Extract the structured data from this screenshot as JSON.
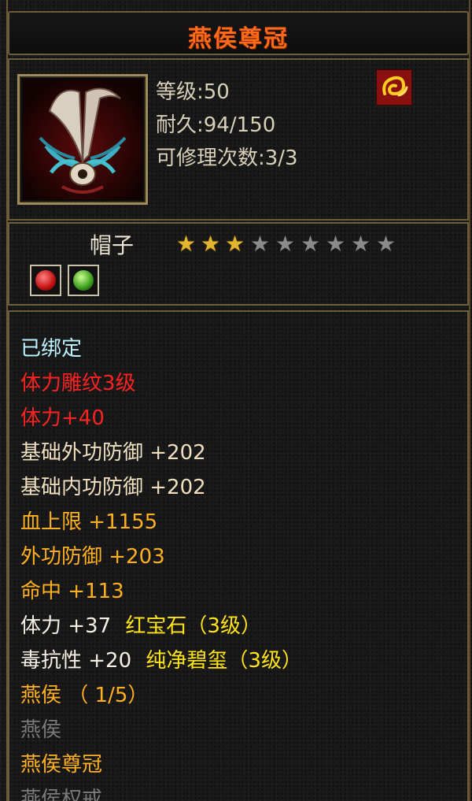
{
  "title": "燕侯尊冠",
  "info": {
    "level": "等级:50",
    "durability": "耐久:94/150",
    "repairs": "可修理次数:3/3"
  },
  "item_type": "帽子",
  "stars": {
    "filled": 3,
    "total": 9
  },
  "attributes": [
    {
      "text": "已绑定",
      "color": "cyan"
    },
    {
      "text": "体力雕纹3级",
      "color": "red"
    },
    {
      "text": "体力+40",
      "color": "red"
    },
    {
      "text": "基础外功防御 +202",
      "color": "beige"
    },
    {
      "text": "基础内功防御 +202",
      "color": "beige"
    },
    {
      "text": "血上限 +1155",
      "color": "orange"
    },
    {
      "text": "外功防御 +203",
      "color": "orange"
    },
    {
      "text": "命中 +113",
      "color": "orange"
    }
  ],
  "gem_lines": [
    {
      "stat": "体力 +37",
      "gem": "红宝石（3级）"
    },
    {
      "stat": "毒抗性 +20",
      "gem": "纯净碧玺（3级）"
    }
  ],
  "set": {
    "name": "燕侯 （ 1/5）",
    "items": [
      {
        "text": "燕侯",
        "color": "gray"
      },
      {
        "text": "燕侯尊冠",
        "color": "orange"
      },
      {
        "text": "燕侯权戒",
        "color": "gray"
      }
    ]
  }
}
